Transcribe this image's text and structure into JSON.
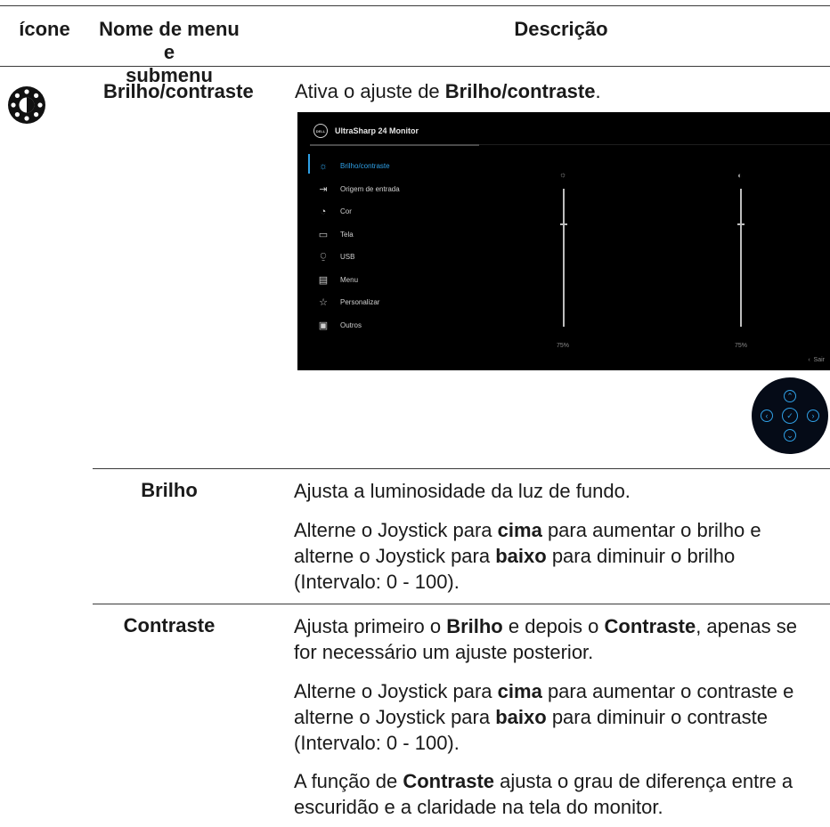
{
  "header": {
    "col_icon": "ícone",
    "col_menu_line1": "Nome de menu e",
    "col_menu_line2": "submenu",
    "col_desc": "Descrição"
  },
  "main_row": {
    "name": "Brilho/contraste",
    "desc_prefix": "Ativa o ajuste de ",
    "desc_bold": "Brilho/contraste",
    "desc_suffix": ".",
    "icon": "brightness-contrast-icon"
  },
  "osd": {
    "logo": "DELL",
    "title": "UltraSharp 24 Monitor",
    "menu": [
      {
        "label": "Brilho/contraste",
        "icon": "sun-icon",
        "glyph": "☼",
        "active": true
      },
      {
        "label": "Origem de entrada",
        "icon": "input-source-icon",
        "glyph": "⇥",
        "active": false
      },
      {
        "label": "Cor",
        "icon": "color-palette-icon",
        "glyph": "◔",
        "active": false
      },
      {
        "label": "Tela",
        "icon": "display-icon",
        "glyph": "▭",
        "active": false
      },
      {
        "label": "USB",
        "icon": "usb-icon",
        "glyph": "⍜",
        "active": false
      },
      {
        "label": "Menu",
        "icon": "menu-icon",
        "glyph": "▤",
        "active": false
      },
      {
        "label": "Personalizar",
        "icon": "star-icon",
        "glyph": "☆",
        "active": false
      },
      {
        "label": "Outros",
        "icon": "others-icon",
        "glyph": "▣",
        "active": false
      }
    ],
    "brightness_icon": "☼",
    "contrast_icon": "◐",
    "brightness_value": "75%",
    "contrast_value": "75%",
    "brightness_level": 75,
    "contrast_level": 75,
    "exit_label": "Sair",
    "exit_glyph": "‹"
  },
  "joystick": {
    "up": "⌃",
    "down": "⌄",
    "left": "‹",
    "right": "›",
    "center": "✓"
  },
  "rows": {
    "brilho": {
      "name": "Brilho",
      "p1": "Ajusta a luminosidade da luz de fundo.",
      "p2a": "Alterne o Joystick para ",
      "p2b": "cima",
      "p2c": " para aumentar o brilho e alterne o Joystick para ",
      "p2d": "baixo",
      "p2e": " para diminuir o brilho (Intervalo: 0 - 100)."
    },
    "contraste": {
      "name": "Contraste",
      "p1a": "Ajusta primeiro o ",
      "p1b": "Brilho",
      "p1c": " e depois o ",
      "p1d": "Contraste",
      "p1e": ", apenas se for necessário um ajuste posterior.",
      "p2a": "Alterne o Joystick para ",
      "p2b": "cima",
      "p2c": " para aumentar o contraste e alterne o Joystick para ",
      "p2d": "baixo",
      "p2e": " para diminuir o contraste (Intervalo: 0 - 100).",
      "p3a": "A função de ",
      "p3b": "Contraste",
      "p3c": " ajusta o grau de diferença entre a escuridão e a claridade na tela do monitor."
    }
  }
}
